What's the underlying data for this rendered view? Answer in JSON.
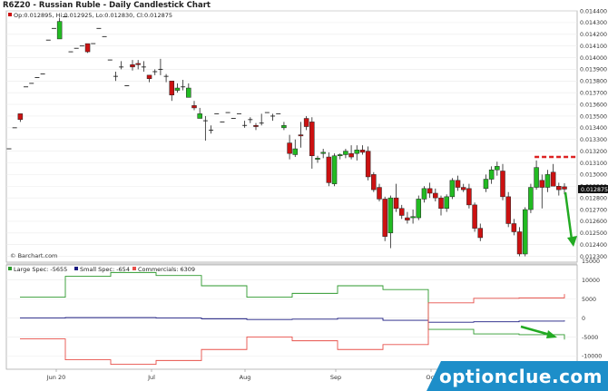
{
  "chart_title": "R6Z20 - Russian Ruble - Daily Candlestick Chart",
  "ohlc_legend": "Op:0.012895, Hi:0.012925, Lo:0.012830, Cl:0.012875",
  "attribution": "© Barchart.com",
  "brand_watermark": "optionclue.com",
  "colors": {
    "up": "#22bb22",
    "down": "#cc1111",
    "large_spec": "#2e9a2e",
    "small_spec": "#1a1a80",
    "commercials": "#e8504a",
    "resistance": "#dd2222",
    "arrow": "#22aa22"
  },
  "chart_data": [
    {
      "type": "candlestick",
      "title": "R6Z20 - Russian Ruble - Daily Candlestick Chart",
      "ylim": [
        0.01225,
        0.0144
      ],
      "y_ticks": [
        "0.014400",
        "0.014300",
        "0.014200",
        "0.014100",
        "0.014000",
        "0.013900",
        "0.013800",
        "0.013700",
        "0.013600",
        "0.013500",
        "0.013400",
        "0.013300",
        "0.013200",
        "0.013100",
        "0.013000",
        "0.012900",
        "0.012800",
        "0.012700",
        "0.012600",
        "0.012500",
        "0.012400",
        "0.012300"
      ],
      "last_price_label": "0.012875",
      "x_labels": [
        "Jun 20",
        "Jul",
        "Aug",
        "Sep",
        "Oct"
      ],
      "candles": [
        {
          "o": 0.01322,
          "h": 0.01322,
          "l": 0.01322,
          "c": 0.01322
        },
        {
          "o": 0.0134,
          "h": 0.0134,
          "l": 0.0134,
          "c": 0.0134
        },
        {
          "o": 0.01352,
          "h": 0.01352,
          "l": 0.01345,
          "c": 0.01347
        },
        {
          "o": 0.01375,
          "h": 0.01375,
          "l": 0.01375,
          "c": 0.01375
        },
        {
          "o": 0.01378,
          "h": 0.01378,
          "l": 0.01378,
          "c": 0.01378
        },
        {
          "o": 0.01383,
          "h": 0.01383,
          "l": 0.01383,
          "c": 0.01383
        },
        {
          "o": 0.01386,
          "h": 0.01386,
          "l": 0.01386,
          "c": 0.01386
        },
        {
          "o": 0.01415,
          "h": 0.01415,
          "l": 0.01415,
          "c": 0.01415
        },
        {
          "o": 0.01425,
          "h": 0.01425,
          "l": 0.01425,
          "c": 0.01425
        },
        {
          "o": 0.01416,
          "h": 0.01434,
          "l": 0.01416,
          "c": 0.01431
        },
        {
          "o": 0.01435,
          "h": 0.01435,
          "l": 0.01435,
          "c": 0.01435
        },
        {
          "o": 0.01405,
          "h": 0.01405,
          "l": 0.01405,
          "c": 0.01405
        },
        {
          "o": 0.01408,
          "h": 0.01408,
          "l": 0.01408,
          "c": 0.01408
        },
        {
          "o": 0.0141,
          "h": 0.0141,
          "l": 0.0141,
          "c": 0.0141
        },
        {
          "o": 0.01412,
          "h": 0.01412,
          "l": 0.01404,
          "c": 0.01405
        },
        {
          "o": 0.01412,
          "h": 0.01412,
          "l": 0.01412,
          "c": 0.01412
        },
        {
          "o": 0.01425,
          "h": 0.01425,
          "l": 0.01425,
          "c": 0.01425
        },
        {
          "o": 0.01418,
          "h": 0.01418,
          "l": 0.01418,
          "c": 0.01418
        },
        {
          "o": 0.01398,
          "h": 0.01398,
          "l": 0.01398,
          "c": 0.01398
        },
        {
          "o": 0.01384,
          "h": 0.01388,
          "l": 0.0138,
          "c": 0.01384
        },
        {
          "o": 0.01392,
          "h": 0.01397,
          "l": 0.0139,
          "c": 0.01392
        },
        {
          "o": 0.01376,
          "h": 0.01376,
          "l": 0.01376,
          "c": 0.01376
        },
        {
          "o": 0.01394,
          "h": 0.01398,
          "l": 0.01389,
          "c": 0.01392
        },
        {
          "o": 0.01395,
          "h": 0.01398,
          "l": 0.0139,
          "c": 0.01394
        },
        {
          "o": 0.01392,
          "h": 0.01397,
          "l": 0.01388,
          "c": 0.01392
        },
        {
          "o": 0.01385,
          "h": 0.01385,
          "l": 0.01379,
          "c": 0.01382
        },
        {
          "o": 0.01388,
          "h": 0.0139,
          "l": 0.01385,
          "c": 0.01388
        },
        {
          "o": 0.0139,
          "h": 0.01399,
          "l": 0.01385,
          "c": 0.0139
        },
        {
          "o": 0.01384,
          "h": 0.01386,
          "l": 0.01379,
          "c": 0.01384
        },
        {
          "o": 0.0138,
          "h": 0.0138,
          "l": 0.01363,
          "c": 0.01368
        },
        {
          "o": 0.01372,
          "h": 0.01378,
          "l": 0.0137,
          "c": 0.01374
        },
        {
          "o": 0.01375,
          "h": 0.01381,
          "l": 0.01372,
          "c": 0.01375
        },
        {
          "o": 0.01366,
          "h": 0.01378,
          "l": 0.01366,
          "c": 0.01374
        },
        {
          "o": 0.01359,
          "h": 0.01363,
          "l": 0.01355,
          "c": 0.01357
        },
        {
          "o": 0.01348,
          "h": 0.01357,
          "l": 0.01348,
          "c": 0.01352
        },
        {
          "o": 0.01346,
          "h": 0.0135,
          "l": 0.01329,
          "c": 0.01346
        },
        {
          "o": 0.01338,
          "h": 0.01342,
          "l": 0.01335,
          "c": 0.01338
        },
        {
          "o": 0.01352,
          "h": 0.01352,
          "l": 0.01352,
          "c": 0.01352
        },
        {
          "o": 0.01345,
          "h": 0.01345,
          "l": 0.01345,
          "c": 0.01345
        },
        {
          "o": 0.01353,
          "h": 0.01353,
          "l": 0.01353,
          "c": 0.01353
        },
        {
          "o": 0.01348,
          "h": 0.01348,
          "l": 0.01348,
          "c": 0.01348
        },
        {
          "o": 0.01352,
          "h": 0.01352,
          "l": 0.01352,
          "c": 0.01352
        },
        {
          "o": 0.01342,
          "h": 0.01346,
          "l": 0.0134,
          "c": 0.01342
        },
        {
          "o": 0.01347,
          "h": 0.01349,
          "l": 0.01344,
          "c": 0.01347
        },
        {
          "o": 0.01342,
          "h": 0.01344,
          "l": 0.01338,
          "c": 0.01341
        },
        {
          "o": 0.01344,
          "h": 0.01352,
          "l": 0.01342,
          "c": 0.01344
        },
        {
          "o": 0.01353,
          "h": 0.01353,
          "l": 0.01353,
          "c": 0.01353
        },
        {
          "o": 0.0135,
          "h": 0.01352,
          "l": 0.01346,
          "c": 0.0135
        },
        {
          "o": 0.01352,
          "h": 0.01352,
          "l": 0.01352,
          "c": 0.01352
        },
        {
          "o": 0.0134,
          "h": 0.01345,
          "l": 0.01338,
          "c": 0.01342
        },
        {
          "o": 0.01327,
          "h": 0.01334,
          "l": 0.01313,
          "c": 0.01318
        },
        {
          "o": 0.01317,
          "h": 0.0133,
          "l": 0.01315,
          "c": 0.01322
        },
        {
          "o": 0.01334,
          "h": 0.01345,
          "l": 0.01323,
          "c": 0.01333
        },
        {
          "o": 0.01348,
          "h": 0.0135,
          "l": 0.01338,
          "c": 0.01341
        },
        {
          "o": 0.01345,
          "h": 0.01349,
          "l": 0.01305,
          "c": 0.01316
        },
        {
          "o": 0.01313,
          "h": 0.01316,
          "l": 0.0131,
          "c": 0.01314
        },
        {
          "o": 0.01318,
          "h": 0.01322,
          "l": 0.01314,
          "c": 0.01319
        },
        {
          "o": 0.01315,
          "h": 0.01319,
          "l": 0.0129,
          "c": 0.01293
        },
        {
          "o": 0.01292,
          "h": 0.01318,
          "l": 0.0129,
          "c": 0.01316
        },
        {
          "o": 0.01316,
          "h": 0.01318,
          "l": 0.01313,
          "c": 0.01317
        },
        {
          "o": 0.01317,
          "h": 0.01322,
          "l": 0.01314,
          "c": 0.0132
        },
        {
          "o": 0.01318,
          "h": 0.01325,
          "l": 0.01313,
          "c": 0.01315
        },
        {
          "o": 0.01318,
          "h": 0.01325,
          "l": 0.01312,
          "c": 0.01321
        },
        {
          "o": 0.01321,
          "h": 0.01325,
          "l": 0.01317,
          "c": 0.01319
        },
        {
          "o": 0.0132,
          "h": 0.01324,
          "l": 0.01295,
          "c": 0.01298
        },
        {
          "o": 0.013,
          "h": 0.01302,
          "l": 0.01285,
          "c": 0.01287
        },
        {
          "o": 0.01289,
          "h": 0.01292,
          "l": 0.01277,
          "c": 0.01279
        },
        {
          "o": 0.01279,
          "h": 0.01281,
          "l": 0.01243,
          "c": 0.01247
        },
        {
          "o": 0.0125,
          "h": 0.01282,
          "l": 0.01237,
          "c": 0.0128
        },
        {
          "o": 0.0128,
          "h": 0.01292,
          "l": 0.01268,
          "c": 0.01271
        },
        {
          "o": 0.01271,
          "h": 0.01274,
          "l": 0.01262,
          "c": 0.01265
        },
        {
          "o": 0.01263,
          "h": 0.01268,
          "l": 0.01258,
          "c": 0.01261
        },
        {
          "o": 0.01263,
          "h": 0.0127,
          "l": 0.01258,
          "c": 0.01264
        },
        {
          "o": 0.01263,
          "h": 0.01282,
          "l": 0.01261,
          "c": 0.01279
        },
        {
          "o": 0.01279,
          "h": 0.0129,
          "l": 0.01276,
          "c": 0.01288
        },
        {
          "o": 0.01288,
          "h": 0.01293,
          "l": 0.0128,
          "c": 0.01284
        },
        {
          "o": 0.01284,
          "h": 0.01288,
          "l": 0.01277,
          "c": 0.0128
        },
        {
          "o": 0.0128,
          "h": 0.01282,
          "l": 0.01265,
          "c": 0.01271
        },
        {
          "o": 0.01271,
          "h": 0.01283,
          "l": 0.01268,
          "c": 0.01281
        },
        {
          "o": 0.01281,
          "h": 0.01297,
          "l": 0.01279,
          "c": 0.01295
        },
        {
          "o": 0.01295,
          "h": 0.01299,
          "l": 0.01286,
          "c": 0.01289
        },
        {
          "o": 0.01289,
          "h": 0.01292,
          "l": 0.01285,
          "c": 0.01287
        },
        {
          "o": 0.01288,
          "h": 0.01292,
          "l": 0.01271,
          "c": 0.01274
        },
        {
          "o": 0.01274,
          "h": 0.01276,
          "l": 0.01251,
          "c": 0.01254
        },
        {
          "o": 0.01254,
          "h": 0.01258,
          "l": 0.01243,
          "c": 0.01246
        },
        {
          "o": 0.01288,
          "h": 0.013,
          "l": 0.01285,
          "c": 0.01296
        },
        {
          "o": 0.01296,
          "h": 0.01307,
          "l": 0.01292,
          "c": 0.01304
        },
        {
          "o": 0.01304,
          "h": 0.01311,
          "l": 0.01299,
          "c": 0.01307
        },
        {
          "o": 0.01303,
          "h": 0.01309,
          "l": 0.01278,
          "c": 0.01281
        },
        {
          "o": 0.01281,
          "h": 0.01285,
          "l": 0.01255,
          "c": 0.01258
        },
        {
          "o": 0.01258,
          "h": 0.01262,
          "l": 0.01248,
          "c": 0.01251
        },
        {
          "o": 0.01251,
          "h": 0.01255,
          "l": 0.0123,
          "c": 0.01232
        },
        {
          "o": 0.01232,
          "h": 0.01272,
          "l": 0.0123,
          "c": 0.0127
        },
        {
          "o": 0.0127,
          "h": 0.01292,
          "l": 0.01267,
          "c": 0.01289
        },
        {
          "o": 0.01289,
          "h": 0.01312,
          "l": 0.01287,
          "c": 0.01306
        },
        {
          "o": 0.01295,
          "h": 0.013,
          "l": 0.01271,
          "c": 0.01289
        },
        {
          "o": 0.01289,
          "h": 0.01304,
          "l": 0.01285,
          "c": 0.013
        },
        {
          "o": 0.01302,
          "h": 0.01309,
          "l": 0.0129,
          "c": 0.0129
        },
        {
          "o": 0.0129,
          "h": 0.01293,
          "l": 0.01282,
          "c": 0.01287
        },
        {
          "o": 0.012895,
          "h": 0.012925,
          "l": 0.01283,
          "c": 0.012875
        }
      ],
      "resistance_level": 0.01315
    },
    {
      "type": "line",
      "legend": [
        "Large Spec: -5655",
        "Small Spec: -654",
        "Commercials: 6309"
      ],
      "ylim": [
        -13500,
        14000
      ],
      "y_ticks": [
        "15000",
        "10000",
        "5000",
        "0",
        "-5000",
        "-10000"
      ],
      "x_labels": [
        "Jun 20",
        "Jul",
        "Aug",
        "Sep",
        "Oct"
      ],
      "series": [
        {
          "name": "Large Spec",
          "values": [
            5500,
            11000,
            12000,
            11200,
            8500,
            5500,
            6500,
            8500,
            7500,
            -3000,
            -4200,
            -4400,
            -5655
          ]
        },
        {
          "name": "Small Spec",
          "values": [
            0,
            100,
            100,
            0,
            -200,
            -400,
            -300,
            -100,
            -600,
            -1100,
            -1000,
            -800,
            -654
          ]
        },
        {
          "name": "Commercials",
          "values": [
            -5500,
            -11000,
            -12200,
            -11200,
            -8300,
            -5000,
            -6000,
            -8300,
            -7000,
            4000,
            5200,
            5300,
            6309
          ]
        }
      ]
    }
  ]
}
